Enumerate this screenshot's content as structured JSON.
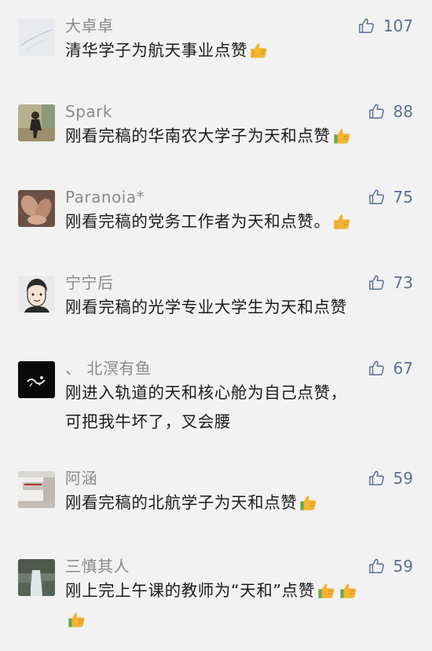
{
  "comments": [
    {
      "name": "大卓卓",
      "likes": "107",
      "lines": [
        "清华学子为航天事业点赞"
      ],
      "thumbs": 1,
      "thumb_on_own_line": false
    },
    {
      "name": "Spark",
      "likes": "88",
      "lines": [
        "刚看完稿的华南农大学子为天和点赞"
      ],
      "thumbs": 1,
      "thumb_on_own_line": false
    },
    {
      "name": "Paranoia*",
      "likes": "75",
      "lines": [
        "刚看完稿的党务工作者为天和点赞。"
      ],
      "thumbs": 1,
      "thumb_on_own_line": false
    },
    {
      "name": "宁宁后",
      "likes": "73",
      "lines": [
        "刚看完稿的光学专业大学生为天和点赞"
      ],
      "thumbs": 0,
      "thumb_on_own_line": false
    },
    {
      "name": "、 北溟有鱼",
      "likes": "67",
      "lines": [
        "刚进入轨道的天和核心舱为自己点赞，",
        "可把我牛坏了，叉会腰"
      ],
      "thumbs": 0,
      "thumb_on_own_line": false
    },
    {
      "name": "阿涵",
      "likes": "59",
      "lines": [
        "刚看完稿的北航学子为天和点赞"
      ],
      "thumbs": 1,
      "thumb_on_own_line": false
    },
    {
      "name": "三慎其人",
      "likes": "59",
      "lines": [
        "刚上完上午课的教师为“天和”点赞"
      ],
      "thumbs": 2,
      "thumb_on_own_line": true
    }
  ],
  "colors": {
    "background": "#f2f2f2",
    "name": "#8a8a8a",
    "like": "#5d6f95",
    "text": "#1c1c1c",
    "thumb_emoji": "#f5b331"
  }
}
